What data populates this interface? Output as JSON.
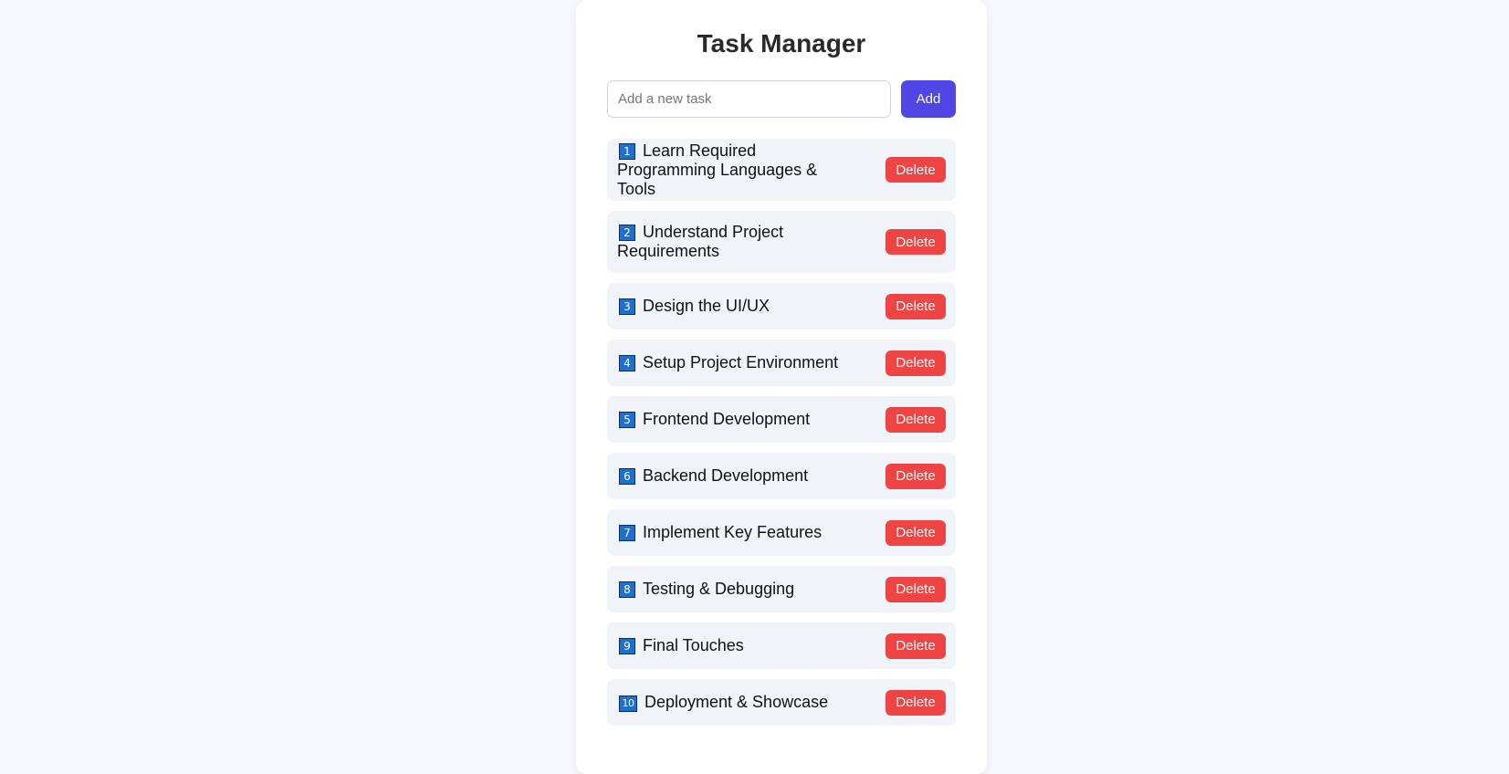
{
  "app": {
    "title": "Task Manager"
  },
  "input": {
    "placeholder": "Add a new task",
    "value": ""
  },
  "add_button": {
    "label": "Add"
  },
  "colors": {
    "accent": "#4f46e5",
    "delete": "#ef4444",
    "item_background": "#f0f3f8",
    "page_background": "#f6f8fc"
  },
  "tasks": [
    {
      "number": "1",
      "text": "Learn Required Programming Languages & Tools",
      "delete_label": "Delete"
    },
    {
      "number": "2",
      "text": "Understand Project Requirements",
      "delete_label": "Delete"
    },
    {
      "number": "3",
      "text": "Design the UI/UX",
      "delete_label": "Delete"
    },
    {
      "number": "4",
      "text": "Setup Project Environment",
      "delete_label": "Delete"
    },
    {
      "number": "5",
      "text": "Frontend Development",
      "delete_label": "Delete"
    },
    {
      "number": "6",
      "text": "Backend Development",
      "delete_label": "Delete"
    },
    {
      "number": "7",
      "text": "Implement Key Features",
      "delete_label": "Delete"
    },
    {
      "number": "8",
      "text": "Testing & Debugging",
      "delete_label": "Delete"
    },
    {
      "number": "9",
      "text": "Final Touches",
      "delete_label": "Delete"
    },
    {
      "number": "10",
      "text": "Deployment & Showcase",
      "delete_label": "Delete"
    }
  ]
}
